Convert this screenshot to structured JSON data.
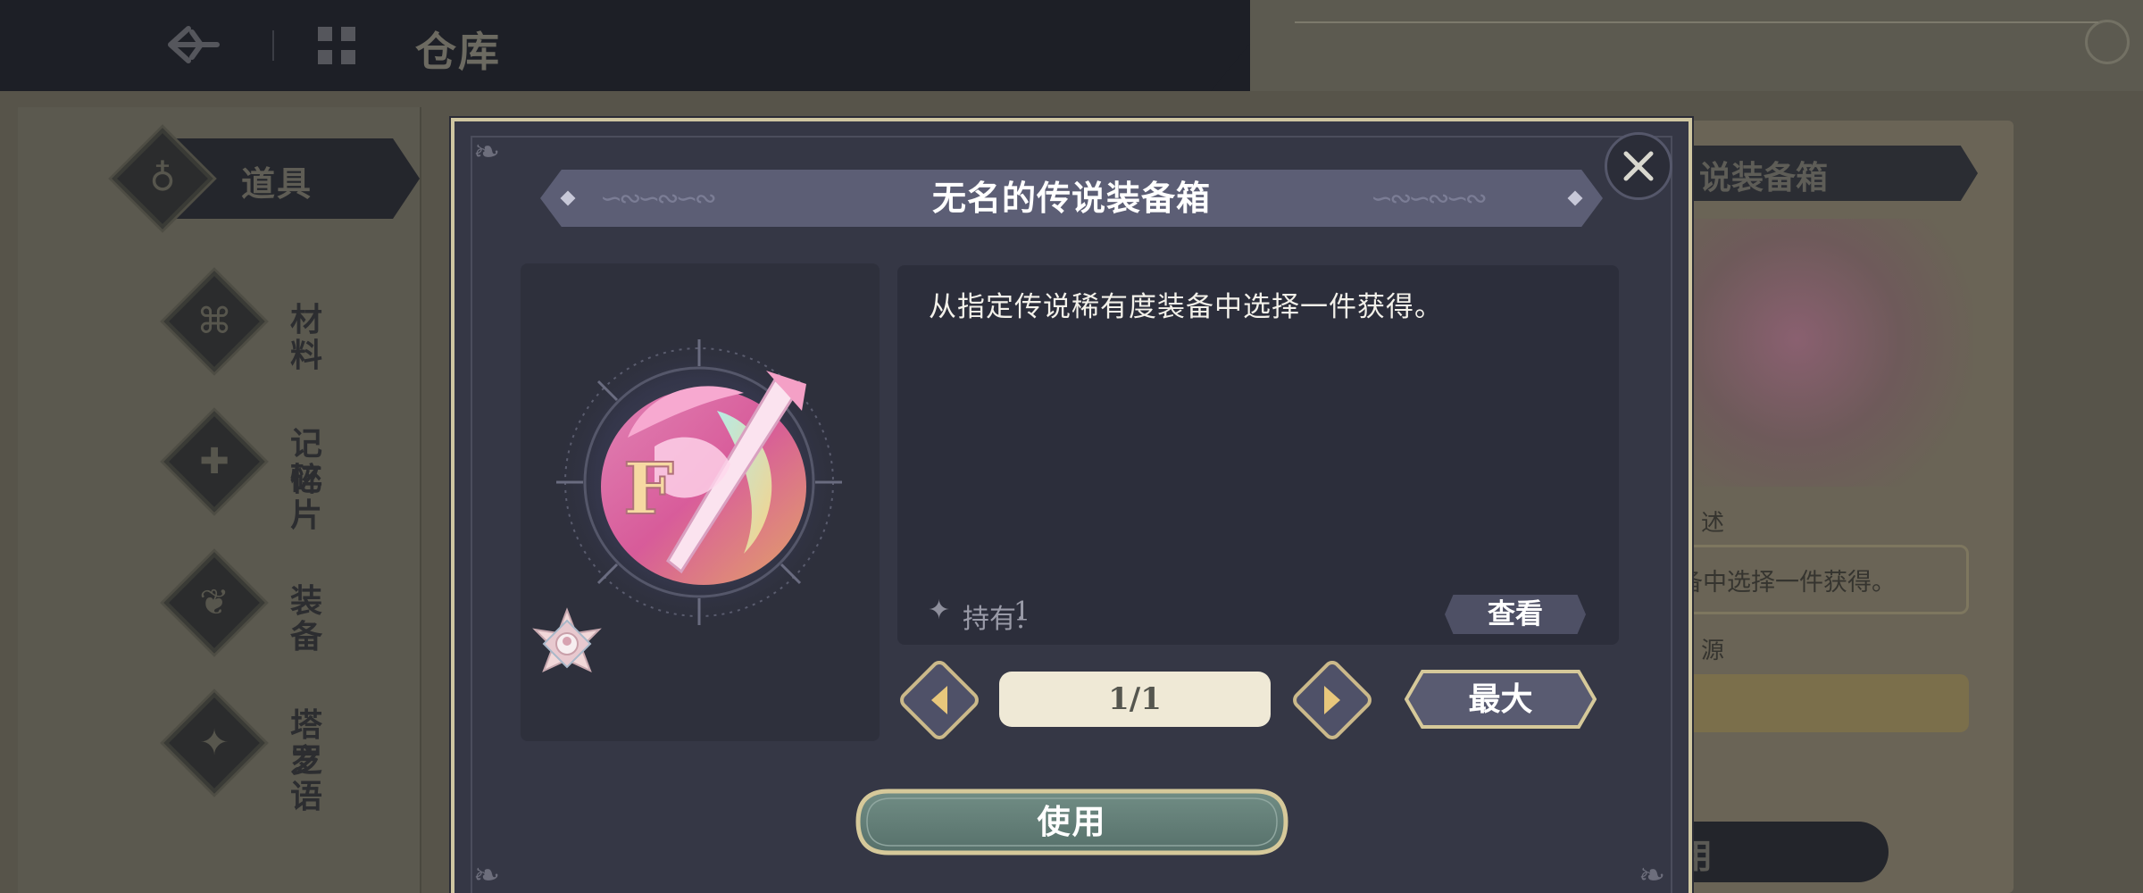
{
  "header": {
    "title": "仓库"
  },
  "sidebar": {
    "items": [
      {
        "label": "道具",
        "active": true
      },
      {
        "label": "材料"
      },
      {
        "label": "记忆",
        "label2": "碎片"
      },
      {
        "label": "装备"
      },
      {
        "label": "塔罗",
        "label2": "之语"
      }
    ]
  },
  "detail_panel": {
    "title": "说装备箱",
    "desc_label": "述",
    "desc_text": "备中选择一件获得。",
    "source_label": "源",
    "use_label": "用"
  },
  "modal": {
    "title": "无名的传说装备箱",
    "description": "从指定传说稀有度装备中选择一件获得。",
    "owned_label": "持有:",
    "owned_value": "1",
    "view_label": "查看",
    "quantity": "1/1",
    "max_label": "最大",
    "use_label": "使用"
  },
  "icons": {
    "back": "back-arrow-icon",
    "warehouse": "warehouse-icon",
    "close": "close-icon",
    "prev": "chevron-left-icon",
    "next": "chevron-right-icon",
    "rarity": "rarity-badge-icon",
    "item": "legendary-equipment-box-icon"
  },
  "colors": {
    "accent_gold": "#cfc6a1",
    "modal_bg": "#353745",
    "use_button": "#5e7770",
    "title_banner": "#5c5e75"
  }
}
